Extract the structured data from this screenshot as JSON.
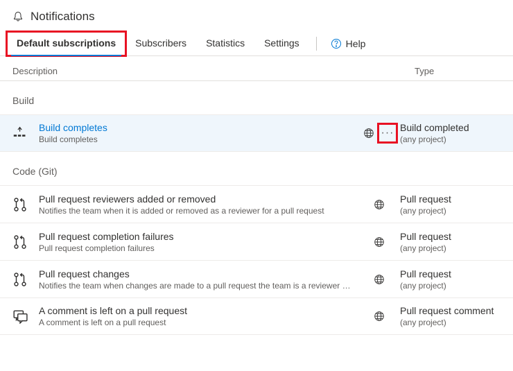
{
  "header": {
    "title": "Notifications"
  },
  "tabs": {
    "items": [
      {
        "label": "Default subscriptions",
        "active": true
      },
      {
        "label": "Subscribers"
      },
      {
        "label": "Statistics"
      },
      {
        "label": "Settings"
      }
    ],
    "help": "Help"
  },
  "columns": {
    "description": "Description",
    "type": "Type"
  },
  "more_glyph": "···",
  "sections": [
    {
      "name": "Build",
      "rows": [
        {
          "icon": "build",
          "title": "Build completes",
          "sub": "Build completes",
          "selected": true,
          "show_more": true,
          "type_title": "Build completed",
          "type_sub": "(any project)"
        }
      ]
    },
    {
      "name": "Code (Git)",
      "rows": [
        {
          "icon": "pr",
          "title": "Pull request reviewers added or removed",
          "sub": "Notifies the team when it is added or removed as a reviewer for a pull request",
          "type_title": "Pull request",
          "type_sub": "(any project)"
        },
        {
          "icon": "pr",
          "title": "Pull request completion failures",
          "sub": "Pull request completion failures",
          "type_title": "Pull request",
          "type_sub": "(any project)"
        },
        {
          "icon": "pr",
          "title": "Pull request changes",
          "sub": "Notifies the team when changes are made to a pull request the team is a reviewer for",
          "type_title": "Pull request",
          "type_sub": "(any project)"
        },
        {
          "icon": "comment",
          "title": "A comment is left on a pull request",
          "sub": "A comment is left on a pull request",
          "type_title": "Pull request comment",
          "type_sub": "(any project)"
        }
      ]
    }
  ]
}
